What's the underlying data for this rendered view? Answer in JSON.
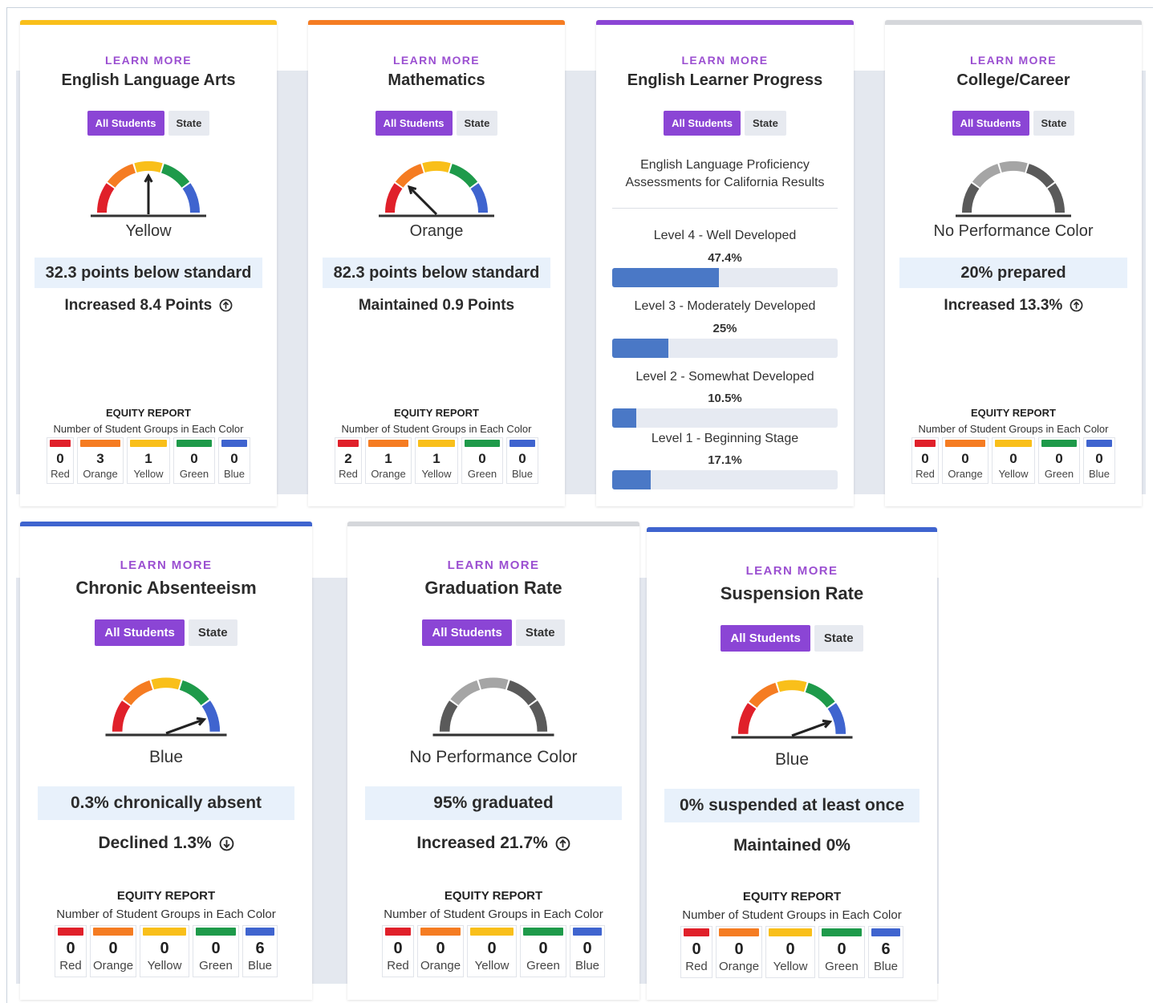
{
  "cards": {
    "ela": {
      "learn_more": "LEARN MORE",
      "title": "English Language Arts",
      "all_students": "All Students",
      "state": "State",
      "color": "Yellow",
      "status": "32.3 points below standard",
      "change": "Increased 8.4 Points",
      "change_icon": "arrow-up-circle-icon",
      "equity": {
        "title": "EQUITY REPORT",
        "subtitle": "Number of Student Groups in Each Color",
        "red": "0",
        "orange": "3",
        "yellow": "1",
        "green": "0",
        "blue": "0"
      }
    },
    "math": {
      "learn_more": "LEARN MORE",
      "title": "Mathematics",
      "all_students": "All Students",
      "state": "State",
      "color": "Orange",
      "status": "82.3 points below standard",
      "change": "Maintained 0.9 Points",
      "equity": {
        "title": "EQUITY REPORT",
        "subtitle": "Number of Student Groups in Each Color",
        "red": "2",
        "orange": "1",
        "yellow": "1",
        "green": "0",
        "blue": "0"
      }
    },
    "elp": {
      "learn_more": "LEARN MORE",
      "title": "English Learner Progress",
      "all_students": "All Students",
      "state": "State",
      "subtitle_line1": "English Language Proficiency",
      "subtitle_line2": "Assessments for California Results",
      "levels": [
        {
          "name": "Level 4 - Well Developed",
          "pct_label": "47.4%",
          "pct": 47.4
        },
        {
          "name": "Level 3 - Moderately Developed",
          "pct_label": "25%",
          "pct": 25
        },
        {
          "name": "Level 2 - Somewhat Developed",
          "pct_label": "10.5%",
          "pct": 10.5
        },
        {
          "name": "Level 1 - Beginning Stage",
          "pct_label": "17.1%",
          "pct": 17.1
        }
      ]
    },
    "cc": {
      "learn_more": "LEARN MORE",
      "title": "College/Career",
      "all_students": "All Students",
      "state": "State",
      "color": "No Performance Color",
      "status": "20% prepared",
      "change": "Increased 13.3%",
      "change_icon": "arrow-up-circle-icon",
      "equity": {
        "title": "EQUITY REPORT",
        "subtitle": "Number of Student Groups in Each Color",
        "red": "0",
        "orange": "0",
        "yellow": "0",
        "green": "0",
        "blue": "0"
      }
    },
    "ca": {
      "learn_more": "LEARN MORE",
      "title": "Chronic Absenteeism",
      "all_students": "All Students",
      "state": "State",
      "color": "Blue",
      "status": "0.3% chronically absent",
      "change": "Declined 1.3%",
      "change_icon": "arrow-down-circle-icon",
      "equity": {
        "title": "EQUITY REPORT",
        "subtitle": "Number of Student Groups in Each Color",
        "red": "0",
        "orange": "0",
        "yellow": "0",
        "green": "0",
        "blue": "6"
      }
    },
    "gr": {
      "learn_more": "LEARN MORE",
      "title": "Graduation Rate",
      "all_students": "All Students",
      "state": "State",
      "color": "No Performance Color",
      "status": "95% graduated",
      "change": "Increased 21.7%",
      "change_icon": "arrow-up-circle-icon",
      "equity": {
        "title": "EQUITY REPORT",
        "subtitle": "Number of Student Groups in Each Color",
        "red": "0",
        "orange": "0",
        "yellow": "0",
        "green": "0",
        "blue": "0"
      }
    },
    "sr": {
      "learn_more": "LEARN MORE",
      "title": "Suspension Rate",
      "all_students": "All Students",
      "state": "State",
      "color": "Blue",
      "status": "0% suspended at least once",
      "change": "Maintained 0%",
      "equity": {
        "title": "EQUITY REPORT",
        "subtitle": "Number of Student Groups in Each Color",
        "red": "0",
        "orange": "0",
        "yellow": "0",
        "green": "0",
        "blue": "6"
      }
    }
  },
  "color_names": {
    "red": "Red",
    "orange": "Orange",
    "yellow": "Yellow",
    "green": "Green",
    "blue": "Blue"
  },
  "palette": {
    "red": "#e0202a",
    "orange": "#f57c22",
    "yellow": "#f9bf1a",
    "green": "#1e9a4a",
    "blue": "#3f64cf",
    "gray_dark": "#5a5a5a",
    "gray_light": "#a5a5a5",
    "purple": "#8b45d5",
    "status_bg": "#e8f1fb"
  }
}
